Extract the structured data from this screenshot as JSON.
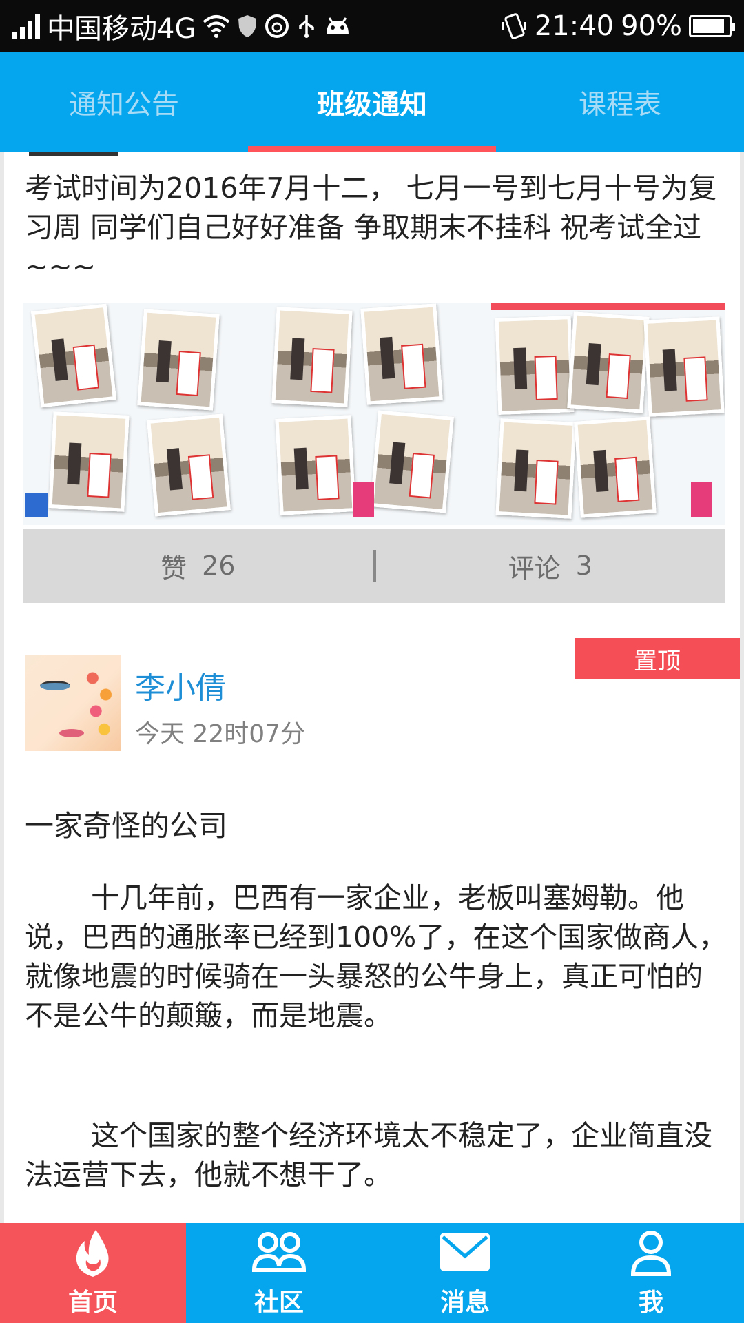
{
  "status_bar": {
    "carrier": "中国移动4G",
    "time": "21:40",
    "battery": "90%",
    "battery_level": 0.9,
    "icons": [
      "signal-icon",
      "wifi-icon",
      "shield-icon",
      "netease-icon",
      "usb-icon",
      "android-icon",
      "vibrate-icon",
      "battery-icon"
    ]
  },
  "tabs": [
    {
      "label": "通知公告",
      "active": false
    },
    {
      "label": "班级通知",
      "active": true
    },
    {
      "label": "课程表",
      "active": false
    }
  ],
  "post1": {
    "text": "考试时间为2016年7月十二， 七月一号到七月十号为复习周 同学们自己好好准备  争取期末不挂科 祝考试全过~~~",
    "like_label": "赞",
    "like_count": "26",
    "comment_label": "评论",
    "comment_count": "3",
    "photo_count": 3
  },
  "post2": {
    "pin_label": "置顶",
    "author": "李小倩",
    "time": "今天 22时07分",
    "title": "一家奇怪的公司",
    "paragraphs": [
      "十几年前，巴西有一家企业，老板叫塞姆勒。他说，巴西的通胀率已经到100%了，在这个国家做商人，就像地震的时候骑在一头暴怒的公牛身上，真正可怕的不是公牛的颠簸，而是地震。",
      "这个国家的整个经济环境太不稳定了，企业简直没法运营下去，他就不想干了。"
    ]
  },
  "bottom_nav": [
    {
      "label": "首页",
      "icon": "flame-icon",
      "active": true
    },
    {
      "label": "社区",
      "icon": "community-icon",
      "active": false
    },
    {
      "label": "消息",
      "icon": "mail-icon",
      "active": false
    },
    {
      "label": "我",
      "icon": "person-icon",
      "active": false
    }
  ],
  "colors": {
    "primary": "#05a6ee",
    "accent": "#f5545a",
    "author_name": "#1e8fd6"
  }
}
